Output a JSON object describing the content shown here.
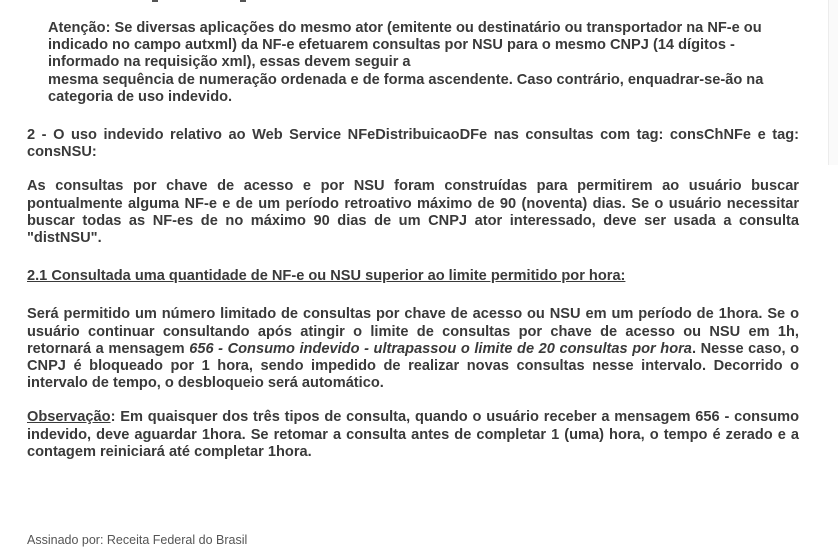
{
  "attention": {
    "line1": "Atenção: Se diversas aplicações do mesmo ator (emitente ou destinatário ou transportador na NF-e ou",
    "line2": "indicado no campo autxml) da NF-e efetuarem consultas por NSU para o mesmo CNPJ (14 dígitos -",
    "line3": "informado na requisição xml), essas devem seguir a",
    "line4": "mesma sequência de numeração ordenada e de forma ascendente. Caso contrário, enquadrar-se-ão na",
    "line5": "categoria de uso indevido."
  },
  "section2": {
    "heading": "2 - O uso indevido relativo ao Web Service NFeDistribuicaoDFe nas consultas com tag: consChNFe e tag: consNSU:",
    "paragraph": "As consultas por chave de acesso e por NSU foram construídas para permitirem ao usuário buscar pontualmente alguma NF-e e de um período retroativo máximo de 90 (noventa) dias. Se o usuário necessitar buscar todas as NF-es de no máximo 90 dias de um CNPJ ator interessado, deve ser usada a consulta \"distNSU\"."
  },
  "section2_1": {
    "heading": "2.1 Consultada uma quantidade de NF-e ou NSU superior ao limite permitido por hora:",
    "paragraph_part1": "Será permitido um número limitado de consultas por chave de acesso ou NSU em um período de 1hora. Se o usuário continuar consultando após atingir o limite de consultas por chave de acesso ou NSU em 1h, retornará a mensagem ",
    "paragraph_italic": "656 - Consumo indevido - ultrapassou o limite de 20 consultas por hora",
    "paragraph_part2": ". Nesse caso, o CNPJ é bloqueado por 1 hora, sendo impedido de realizar novas consultas nesse intervalo. Decorrido o intervalo de tempo, o desbloqueio será automático."
  },
  "observation": {
    "label": "Observação",
    "text": ": Em quaisquer dos três tipos de consulta, quando o usuário receber a mensagem 656 - consumo indevido, deve aguardar 1hora. Se retomar a consulta antes de completar 1 (uma) hora, o tempo é zerado e a contagem reiniciará até completar 1hora."
  },
  "footer": {
    "signed": "Assinado por: Receita Federal do Brasil"
  }
}
